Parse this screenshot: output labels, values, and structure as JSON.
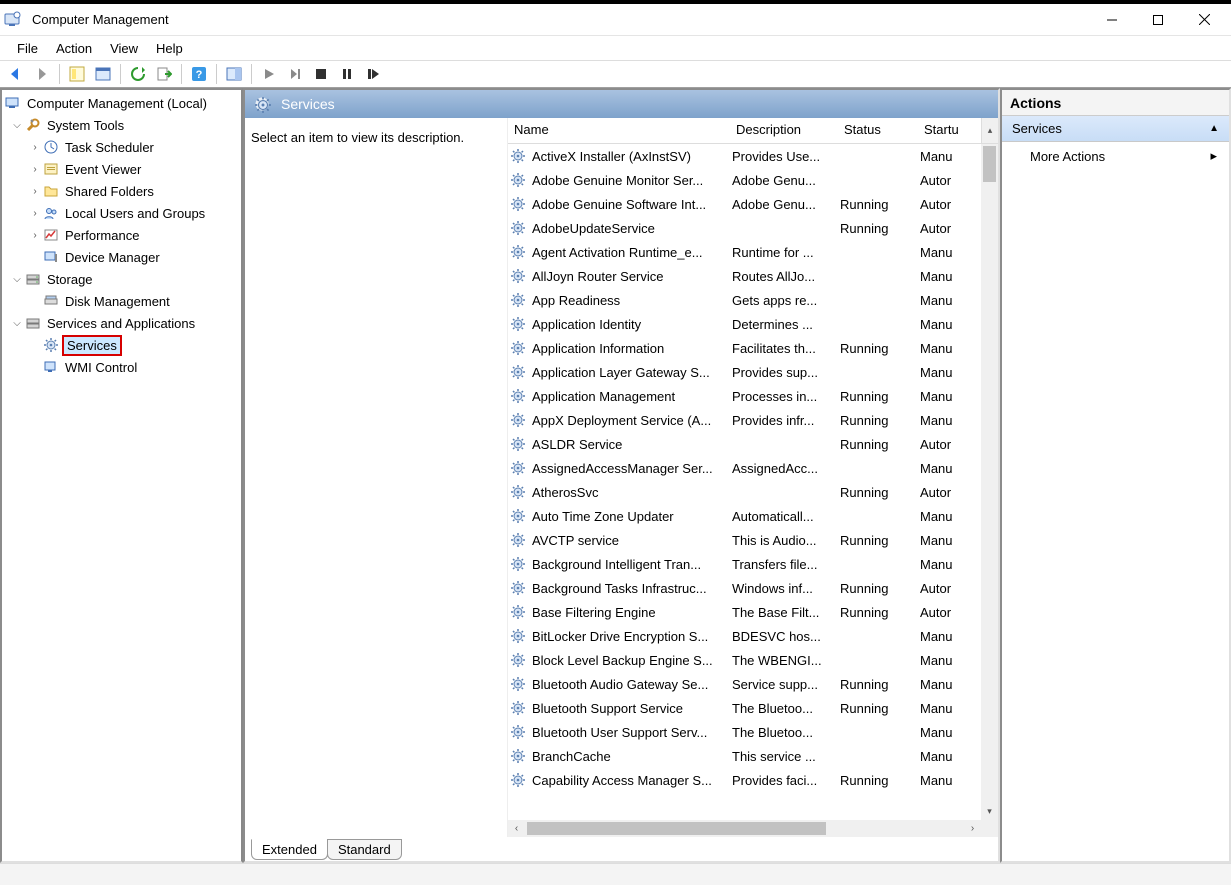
{
  "window": {
    "title": "Computer Management"
  },
  "menu": [
    "File",
    "Action",
    "View",
    "Help"
  ],
  "tree": {
    "root": "Computer Management (Local)",
    "systools": "System Tools",
    "systools_items": [
      "Task Scheduler",
      "Event Viewer",
      "Shared Folders",
      "Local Users and Groups",
      "Performance",
      "Device Manager"
    ],
    "storage": "Storage",
    "storage_items": [
      "Disk Management"
    ],
    "svcapp": "Services and Applications",
    "svcapp_items": [
      "Services",
      "WMI Control"
    ]
  },
  "center": {
    "header": "Services",
    "hint": "Select an item to view its description.",
    "columns": {
      "name": "Name",
      "description": "Description",
      "status": "Status",
      "startup": "Startu"
    },
    "tabs": [
      "Extended",
      "Standard"
    ]
  },
  "actions": {
    "title": "Actions",
    "section": "Services",
    "more": "More Actions"
  },
  "services": [
    {
      "name": "ActiveX Installer (AxInstSV)",
      "desc": "Provides Use...",
      "status": "",
      "startup": "Manu"
    },
    {
      "name": "Adobe Genuine Monitor Ser...",
      "desc": "Adobe Genu...",
      "status": "",
      "startup": "Autor"
    },
    {
      "name": "Adobe Genuine Software Int...",
      "desc": "Adobe Genu...",
      "status": "Running",
      "startup": "Autor"
    },
    {
      "name": "AdobeUpdateService",
      "desc": "",
      "status": "Running",
      "startup": "Autor"
    },
    {
      "name": "Agent Activation Runtime_e...",
      "desc": "Runtime for ...",
      "status": "",
      "startup": "Manu"
    },
    {
      "name": "AllJoyn Router Service",
      "desc": "Routes AllJo...",
      "status": "",
      "startup": "Manu"
    },
    {
      "name": "App Readiness",
      "desc": "Gets apps re...",
      "status": "",
      "startup": "Manu"
    },
    {
      "name": "Application Identity",
      "desc": "Determines ...",
      "status": "",
      "startup": "Manu"
    },
    {
      "name": "Application Information",
      "desc": "Facilitates th...",
      "status": "Running",
      "startup": "Manu"
    },
    {
      "name": "Application Layer Gateway S...",
      "desc": "Provides sup...",
      "status": "",
      "startup": "Manu"
    },
    {
      "name": "Application Management",
      "desc": "Processes in...",
      "status": "Running",
      "startup": "Manu"
    },
    {
      "name": "AppX Deployment Service (A...",
      "desc": "Provides infr...",
      "status": "Running",
      "startup": "Manu"
    },
    {
      "name": "ASLDR Service",
      "desc": "",
      "status": "Running",
      "startup": "Autor"
    },
    {
      "name": "AssignedAccessManager Ser...",
      "desc": "AssignedAcc...",
      "status": "",
      "startup": "Manu"
    },
    {
      "name": "AtherosSvc",
      "desc": "",
      "status": "Running",
      "startup": "Autor"
    },
    {
      "name": "Auto Time Zone Updater",
      "desc": "Automaticall...",
      "status": "",
      "startup": "Manu"
    },
    {
      "name": "AVCTP service",
      "desc": "This is Audio...",
      "status": "Running",
      "startup": "Manu"
    },
    {
      "name": "Background Intelligent Tran...",
      "desc": "Transfers file...",
      "status": "",
      "startup": "Manu"
    },
    {
      "name": "Background Tasks Infrastruc...",
      "desc": "Windows inf...",
      "status": "Running",
      "startup": "Autor"
    },
    {
      "name": "Base Filtering Engine",
      "desc": "The Base Filt...",
      "status": "Running",
      "startup": "Autor"
    },
    {
      "name": "BitLocker Drive Encryption S...",
      "desc": "BDESVC hos...",
      "status": "",
      "startup": "Manu"
    },
    {
      "name": "Block Level Backup Engine S...",
      "desc": "The WBENGI...",
      "status": "",
      "startup": "Manu"
    },
    {
      "name": "Bluetooth Audio Gateway Se...",
      "desc": "Service supp...",
      "status": "Running",
      "startup": "Manu"
    },
    {
      "name": "Bluetooth Support Service",
      "desc": "The Bluetoo...",
      "status": "Running",
      "startup": "Manu"
    },
    {
      "name": "Bluetooth User Support Serv...",
      "desc": "The Bluetoo...",
      "status": "",
      "startup": "Manu"
    },
    {
      "name": "BranchCache",
      "desc": "This service ...",
      "status": "",
      "startup": "Manu"
    },
    {
      "name": "Capability Access Manager S...",
      "desc": "Provides faci...",
      "status": "Running",
      "startup": "Manu"
    }
  ]
}
